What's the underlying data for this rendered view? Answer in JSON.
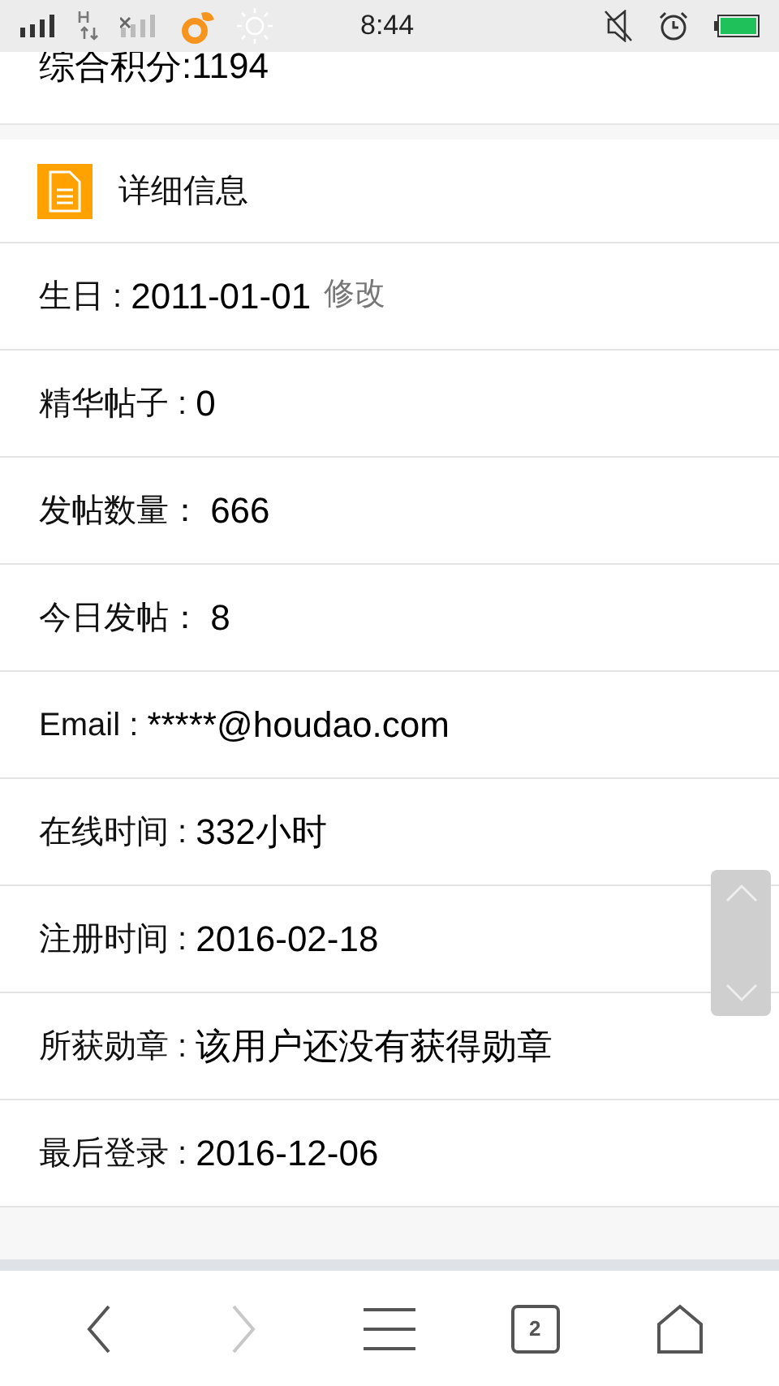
{
  "status_bar": {
    "time": "8:44"
  },
  "score": {
    "label": "综合积分:",
    "value": "1194"
  },
  "section": {
    "title": "详细信息"
  },
  "rows": [
    {
      "label": "生日 : ",
      "value": "2011-01-01",
      "link": "修改"
    },
    {
      "label": "精华帖子 : ",
      "value": "0"
    },
    {
      "label": "发帖数量： ",
      "value": "666"
    },
    {
      "label": "今日发帖： ",
      "value": "8"
    },
    {
      "label": "Email : ",
      "value": "*****@houdao.com"
    },
    {
      "label": "在线时间 : ",
      "value": "332小时"
    },
    {
      "label": "注册时间 : ",
      "value": "2016-02-18"
    },
    {
      "label": "所获勋章 : ",
      "value": "该用户还没有获得勋章"
    },
    {
      "label": "最后登录 : ",
      "value": "2016-12-06"
    }
  ],
  "nav": [
    {
      "kind": "back",
      "disabled": false
    },
    {
      "kind": "forward",
      "disabled": true
    },
    {
      "kind": "menu",
      "disabled": false
    },
    {
      "kind": "tabs",
      "disabled": false,
      "count": "2"
    },
    {
      "kind": "home",
      "disabled": false
    }
  ]
}
